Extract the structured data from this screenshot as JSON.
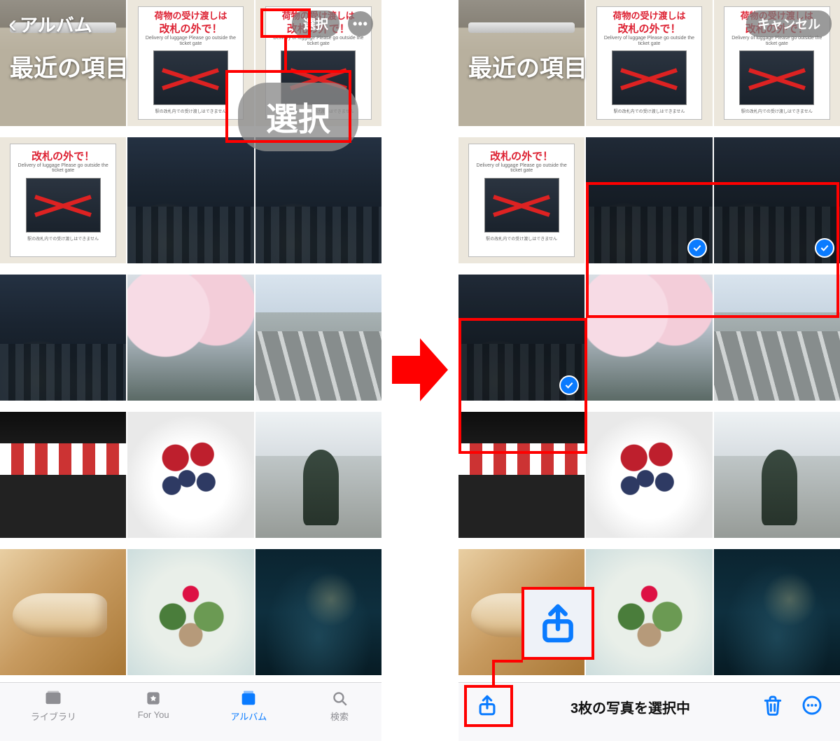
{
  "left": {
    "back_label": "アルバム",
    "select_pill": "選択",
    "album_title": "最近の項目",
    "big_select": "選択",
    "tabs": {
      "library": "ライブラリ",
      "for_you": "For You",
      "albums": "アルバム",
      "search": "検索"
    }
  },
  "right": {
    "cancel_pill": "キャンセル",
    "album_title": "最近の項目",
    "status": "3枚の写真を選択中"
  },
  "sign": {
    "line1": "荷物の受け渡しは",
    "line2": "改札の外で！",
    "sub": "Delivery of luggage Please go outside the ticket gate",
    "foot": "駅の改札内での受け渡しはできません"
  },
  "colors": {
    "accent": "#0a7bff",
    "annotation": "#ff0000"
  }
}
